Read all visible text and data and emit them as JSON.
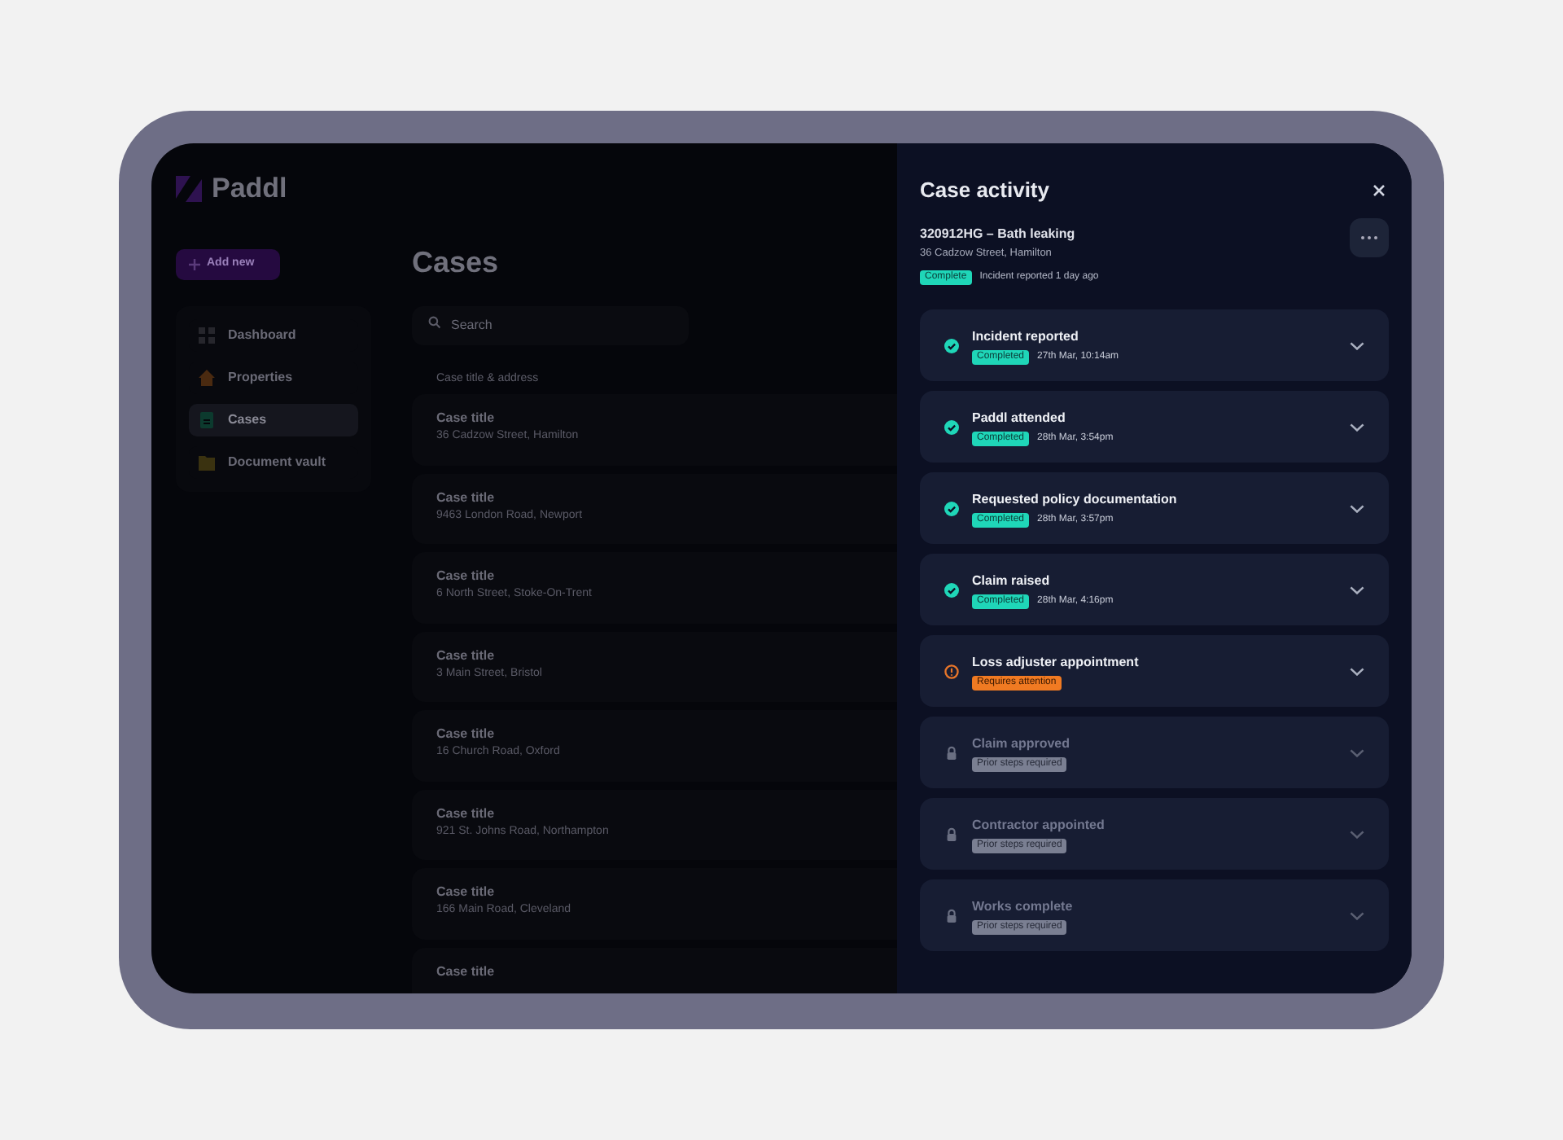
{
  "app": {
    "logo": "Paddl",
    "add_button": "Add new",
    "nav": [
      {
        "label": "Dashboard",
        "selected": false
      },
      {
        "label": "Properties",
        "selected": false
      },
      {
        "label": "Cases",
        "selected": true
      },
      {
        "label": "Document vault",
        "selected": false
      }
    ],
    "page_title": "Cases",
    "search": {
      "placeholder": "Search"
    },
    "column_header": "Case title & address",
    "cases": [
      {
        "title": "Case title",
        "address": "36 Cadzow Street, Hamilton"
      },
      {
        "title": "Case title",
        "address": "9463 London Road, Newport"
      },
      {
        "title": "Case title",
        "address": "6 North Street, Stoke-On-Trent"
      },
      {
        "title": "Case title",
        "address": "3 Main Street, Bristol"
      },
      {
        "title": "Case title",
        "address": "16 Church Road, Oxford"
      },
      {
        "title": "Case title",
        "address": "921 St. Johns Road, Northampton"
      },
      {
        "title": "Case title",
        "address": "166 Main Road, Cleveland"
      },
      {
        "title": "Case title"
      }
    ]
  },
  "panel": {
    "title": "Case activity",
    "case_name": "320912HG – Bath leaking",
    "address": "36 Cadzow Street, Hamilton",
    "status": "Complete",
    "reported": "Incident reported 1 day ago",
    "steps": [
      {
        "kind": "completed",
        "title": "Incident reported",
        "status": "Completed",
        "time": "27th Mar, 10:14am"
      },
      {
        "kind": "completed",
        "title": "Paddl attended",
        "status": "Completed",
        "time": "28th Mar, 3:54pm"
      },
      {
        "kind": "completed",
        "title": "Requested policy documentation",
        "status": "Completed",
        "time": "28th Mar, 3:57pm"
      },
      {
        "kind": "completed",
        "title": "Claim raised",
        "status": "Completed",
        "time": "28th Mar, 4:16pm"
      },
      {
        "kind": "attention",
        "title": "Loss adjuster appointment",
        "status": "Requires attention"
      },
      {
        "kind": "locked",
        "title": "Claim approved",
        "status": "Prior steps required"
      },
      {
        "kind": "locked",
        "title": "Contractor appointed",
        "status": "Prior steps required"
      },
      {
        "kind": "locked",
        "title": "Works complete",
        "status": "Prior steps required"
      }
    ]
  }
}
